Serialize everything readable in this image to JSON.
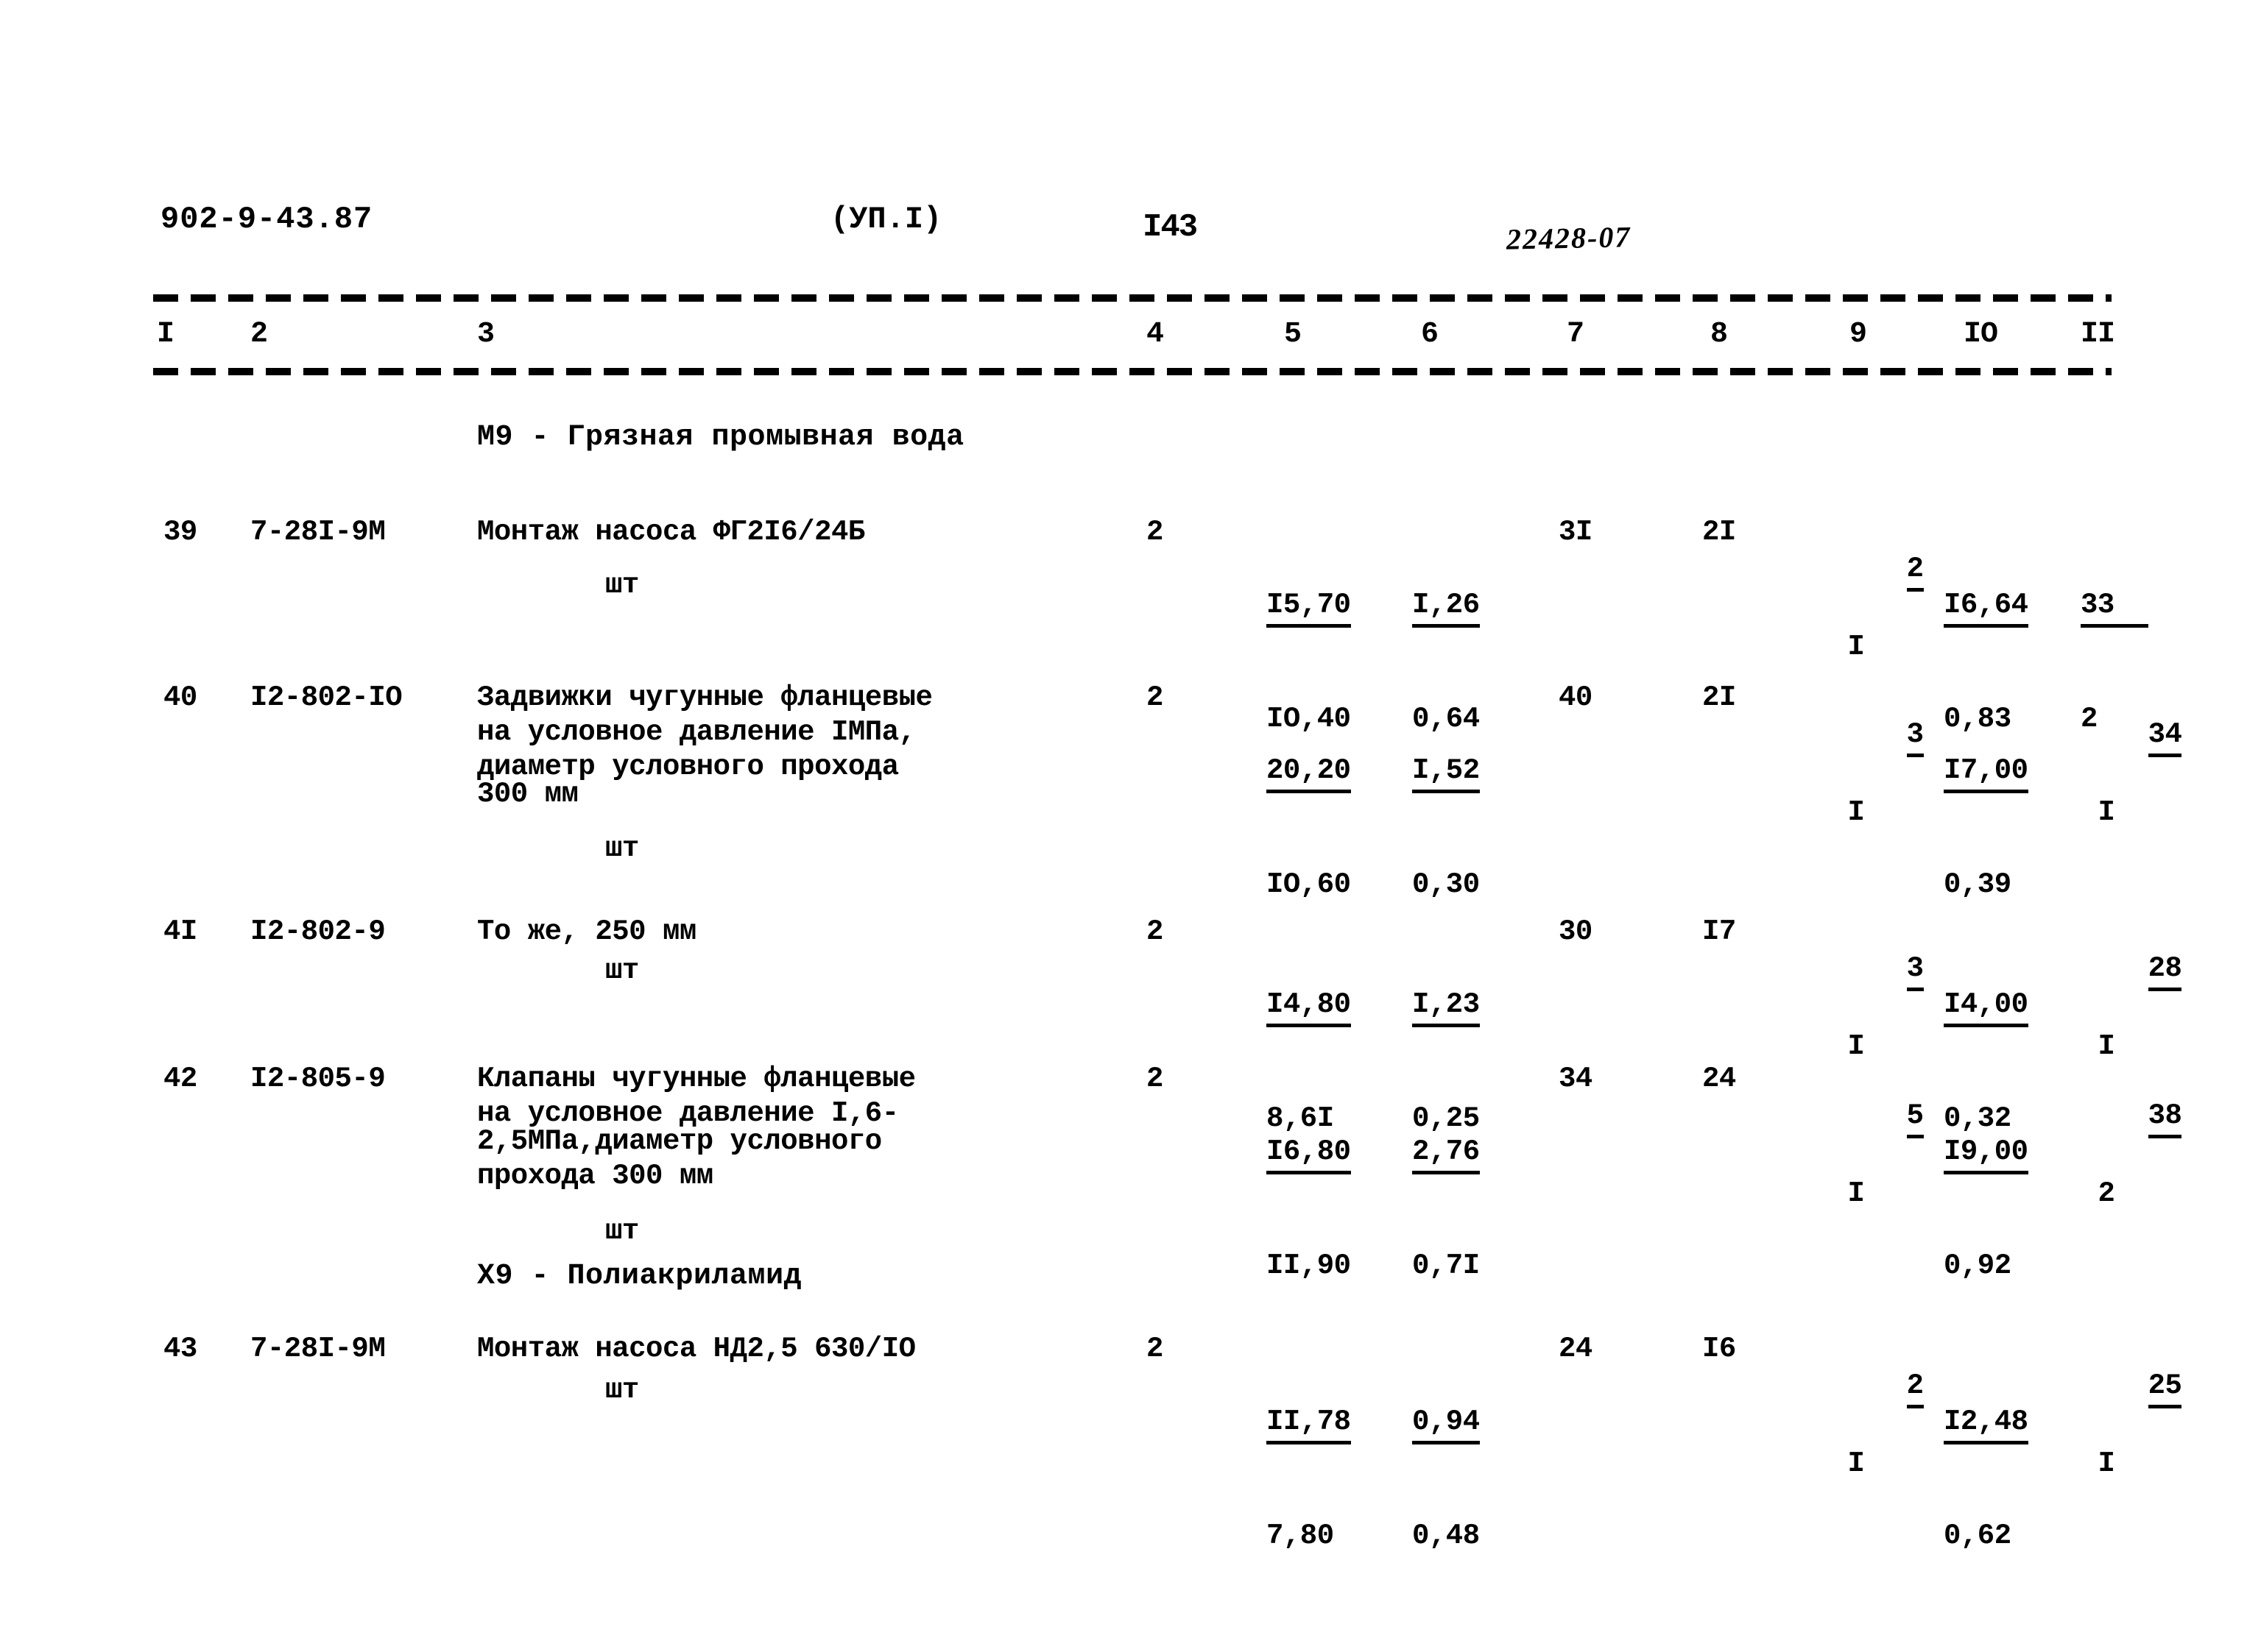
{
  "header": {
    "doc_code": "902-9-43.87",
    "sheet_ref": "(УП.I)",
    "page_number": "I43",
    "stamp_number": "22428-07"
  },
  "table": {
    "column_headers": [
      "I",
      "2",
      "3",
      "4",
      "5",
      "6",
      "7",
      "8",
      "9",
      "IO",
      "II"
    ],
    "sections": [
      {
        "title": "М9 - Грязная промывная вода"
      },
      {
        "title": "Х9 - Полиакриламид"
      }
    ],
    "rows": [
      {
        "num": "39",
        "code": "7-28I-9M",
        "desc_lines": [
          "Монтаж насоса ФГ2I6/24Б"
        ],
        "unit": "шт",
        "qty": "2",
        "c5_num": "I5,70",
        "c5_den": "IO,40",
        "c6_num": "I,26",
        "c6_den": "0,64",
        "c7": "3I",
        "c8": "2I",
        "c9_num": "2",
        "c9_den": "I",
        "c10_num": "I6,64",
        "c10_den": "0,83",
        "c11_num": "33",
        "c11_den": "2"
      },
      {
        "num": "40",
        "code": "I2-802-IO",
        "desc_lines": [
          "Задвижки чугунные фланцевые",
          "на условное давление IМПа,",
          "диаметр условного прохода",
          "300 мм"
        ],
        "unit": "шт",
        "qty": "2",
        "c5_num": "20,20",
        "c5_den": "IO,60",
        "c6_num": "I,52",
        "c6_den": "0,30",
        "c7": "40",
        "c8": "2I",
        "c9_num": "3",
        "c9_den": "I",
        "c10_num": "I7,00",
        "c10_den": "0,39",
        "c11_num": "34",
        "c11_den": "I"
      },
      {
        "num": "4I",
        "code": "I2-802-9",
        "desc_lines": [
          "То же, 250 мм"
        ],
        "unit": "шт",
        "qty": "2",
        "c5_num": "I4,80",
        "c5_den": "8,6I",
        "c6_num": "I,23",
        "c6_den": "0,25",
        "c7": "30",
        "c8": "I7",
        "c9_num": "3",
        "c9_den": "I",
        "c10_num": "I4,00",
        "c10_den": "0,32",
        "c11_num": "28",
        "c11_den": "I"
      },
      {
        "num": "42",
        "code": "I2-805-9",
        "desc_lines": [
          "Клапаны чугунные фланцевые",
          "на условное давление I,6-",
          "2,5МПа,диаметр условного",
          "прохода 300 мм"
        ],
        "unit": "шт",
        "qty": "2",
        "c5_num": "I6,80",
        "c5_den": "II,90",
        "c6_num": "2,76",
        "c6_den": "0,7I",
        "c7": "34",
        "c8": "24",
        "c9_num": "5",
        "c9_den": "I",
        "c10_num": "I9,00",
        "c10_den": "0,92",
        "c11_num": "38",
        "c11_den": "2"
      },
      {
        "num": "43",
        "code": "7-28I-9M",
        "desc_lines": [
          "Монтаж насоса НД2,5 630/IO"
        ],
        "unit": "шт",
        "qty": "2",
        "c5_num": "II,78",
        "c5_den": "7,80",
        "c6_num": "0,94",
        "c6_den": "0,48",
        "c7": "24",
        "c8": "I6",
        "c9_num": "2",
        "c9_den": "I",
        "c10_num": "I2,48",
        "c10_den": "0,62",
        "c11_num": "25",
        "c11_den": "I"
      }
    ]
  }
}
